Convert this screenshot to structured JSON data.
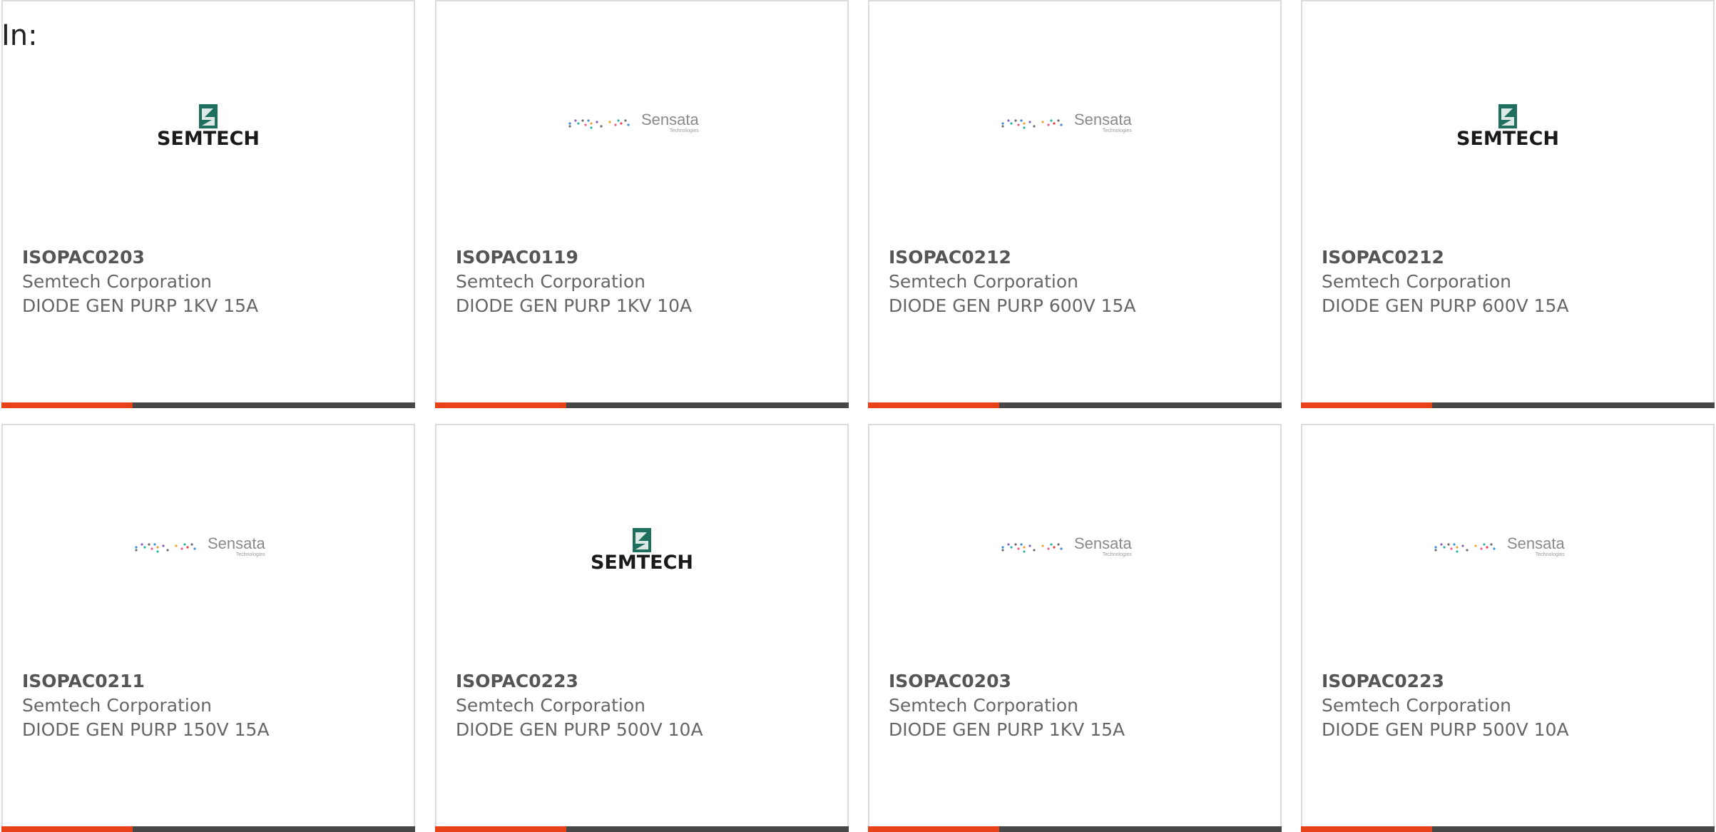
{
  "prefix_label": "In:",
  "colors": {
    "accent": "#e8421a",
    "bar_dark": "#474747",
    "text": "#666666",
    "semtech_green": "#1f6f5f"
  },
  "cards": [
    {
      "part_number": "ISOPAC0203",
      "manufacturer": "Semtech Corporation",
      "description": "DIODE GEN PURP 1KV 15A",
      "logo": "semtech-logo",
      "logo_text": "SEMTECH"
    },
    {
      "part_number": "ISOPAC0119",
      "manufacturer": "Semtech Corporation",
      "description": "DIODE GEN PURP 1KV 10A",
      "logo": "sensata-logo",
      "logo_text": "Sensata",
      "logo_subtext": "Technologies"
    },
    {
      "part_number": "ISOPAC0212",
      "manufacturer": "Semtech Corporation",
      "description": "DIODE GEN PURP 600V 15A",
      "logo": "sensata-logo",
      "logo_text": "Sensata",
      "logo_subtext": "Technologies"
    },
    {
      "part_number": "ISOPAC0212",
      "manufacturer": "Semtech Corporation",
      "description": "DIODE GEN PURP 600V 15A",
      "logo": "semtech-logo",
      "logo_text": "SEMTECH"
    },
    {
      "part_number": "ISOPAC0211",
      "manufacturer": "Semtech Corporation",
      "description": "DIODE GEN PURP 150V 15A",
      "logo": "sensata-logo",
      "logo_text": "Sensata",
      "logo_subtext": "Technologies"
    },
    {
      "part_number": "ISOPAC0223",
      "manufacturer": "Semtech Corporation",
      "description": "DIODE GEN PURP 500V 10A",
      "logo": "semtech-logo",
      "logo_text": "SEMTECH"
    },
    {
      "part_number": "ISOPAC0203",
      "manufacturer": "Semtech Corporation",
      "description": "DIODE GEN PURP 1KV 15A",
      "logo": "sensata-logo",
      "logo_text": "Sensata",
      "logo_subtext": "Technologies"
    },
    {
      "part_number": "ISOPAC0223",
      "manufacturer": "Semtech Corporation",
      "description": "DIODE GEN PURP 500V 10A",
      "logo": "sensata-logo",
      "logo_text": "Sensata",
      "logo_subtext": "Technologies"
    }
  ]
}
